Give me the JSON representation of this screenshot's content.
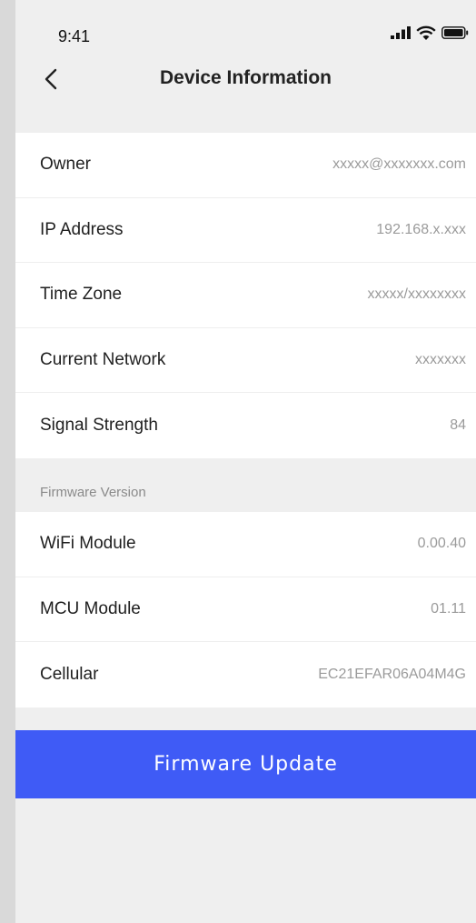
{
  "status_bar": {
    "time": "9:41",
    "icons": [
      "signal-icon",
      "wifi-icon",
      "battery-icon"
    ]
  },
  "header": {
    "back_icon": "chevron-left-icon",
    "title": "Device Information"
  },
  "info_rows": [
    {
      "label": "Owner",
      "value": "xxxxx@xxxxxxx.com"
    },
    {
      "label": "IP Address",
      "value": "192.168.x.xxx"
    },
    {
      "label": "Time Zone",
      "value": "xxxxx/xxxxxxxx"
    },
    {
      "label": "Current Network",
      "value": "xxxxxxx"
    },
    {
      "label": "Signal Strength",
      "value": "84"
    }
  ],
  "firmware_section": {
    "header": "Firmware Version",
    "rows": [
      {
        "label": "WiFi Module",
        "value": "0.00.40"
      },
      {
        "label": "MCU Module",
        "value": "01.11"
      },
      {
        "label": "Cellular",
        "value": "EC21EFAR06A04M4G"
      }
    ]
  },
  "update_button": {
    "label": "Firmware Update",
    "color": "#3f5bf6"
  }
}
